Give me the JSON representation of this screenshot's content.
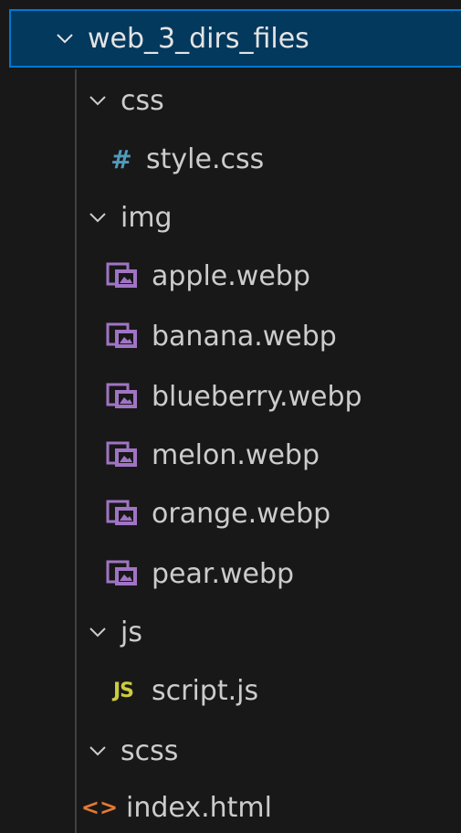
{
  "explorer": {
    "root": {
      "label": "web_3_dirs_files",
      "icon": "chevron-down-icon"
    },
    "css": {
      "label": "css",
      "icon": "chevron-down-icon"
    },
    "style_css": {
      "label": "style.css",
      "icon": "css-file-icon",
      "glyph": "#"
    },
    "img": {
      "label": "img",
      "icon": "chevron-down-icon"
    },
    "images": [
      {
        "label": "apple.webp",
        "icon": "image-file-icon"
      },
      {
        "label": "banana.webp",
        "icon": "image-file-icon"
      },
      {
        "label": "blueberry.webp",
        "icon": "image-file-icon"
      },
      {
        "label": "melon.webp",
        "icon": "image-file-icon"
      },
      {
        "label": "orange.webp",
        "icon": "image-file-icon"
      },
      {
        "label": "pear.webp",
        "icon": "image-file-icon"
      }
    ],
    "js": {
      "label": "js",
      "icon": "chevron-down-icon"
    },
    "script_js": {
      "label": "script.js",
      "icon": "js-file-icon",
      "glyph": "JS"
    },
    "scss": {
      "label": "scss",
      "icon": "chevron-down-icon"
    },
    "index_html": {
      "label": "index.html",
      "icon": "html-file-icon",
      "glyph": "<>"
    }
  },
  "colors": {
    "background": "#181818",
    "selection": "#04395e",
    "focus_border": "#0078d4",
    "css_icon": "#519aba",
    "image_icon": "#a074c4",
    "js_icon": "#cbcb41",
    "html_icon": "#e37933"
  }
}
